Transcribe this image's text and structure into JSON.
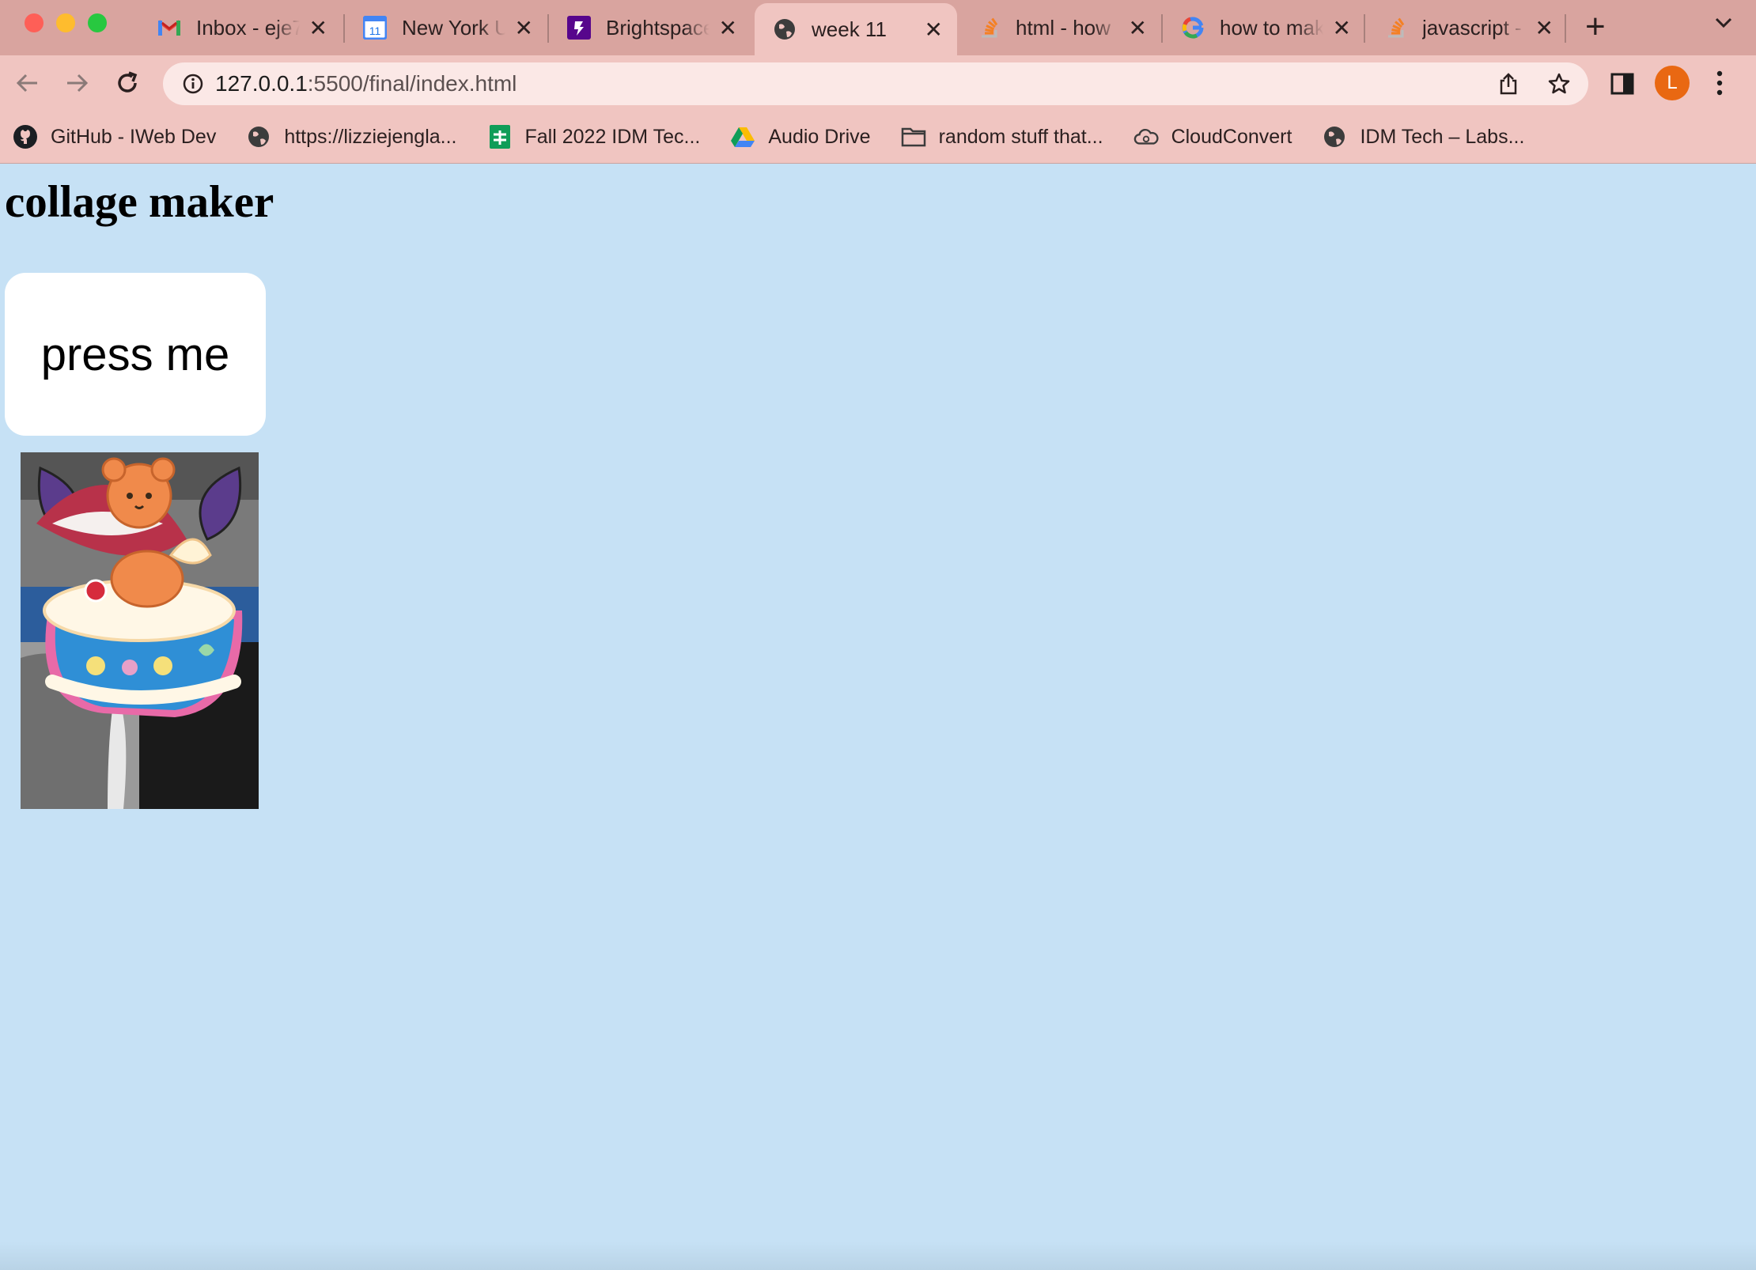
{
  "browser": {
    "tabs": [
      {
        "title": "Inbox - eje7",
        "favicon": "gmail-icon"
      },
      {
        "title": "New York U",
        "favicon": "calendar-icon"
      },
      {
        "title": "Brightspace",
        "favicon": "brightspace-icon"
      },
      {
        "title": "week 11",
        "favicon": "globe-icon",
        "active": true
      },
      {
        "title": "html - how",
        "favicon": "stackoverflow-icon"
      },
      {
        "title": "how to mak",
        "favicon": "google-icon"
      },
      {
        "title": "javascript -",
        "favicon": "stackoverflow-icon"
      }
    ],
    "new_tab_label": "+",
    "close_glyph": "✕",
    "calendar_day": "11",
    "url_host": "127.0.0.1",
    "url_path": ":5500/final/index.html",
    "avatar_letter": "L",
    "bookmarks": [
      {
        "label": "GitHub - IWeb Dev",
        "icon": "github-icon"
      },
      {
        "label": "https://lizziejengla...",
        "icon": "globe-icon"
      },
      {
        "label": "Fall 2022 IDM Tec...",
        "icon": "sheets-icon"
      },
      {
        "label": "Audio Drive",
        "icon": "drive-icon"
      },
      {
        "label": "random stuff that...",
        "icon": "folder-icon"
      },
      {
        "label": "CloudConvert",
        "icon": "cloud-icon"
      },
      {
        "label": "IDM Tech – Labs...",
        "icon": "globe-icon"
      }
    ],
    "colors": {
      "tabstrip": "#d9a49f",
      "toolbar": "#f0c5c1",
      "avatar": "#e96812"
    }
  },
  "page": {
    "heading": "collage maker",
    "button_label": "press me",
    "background": "#c6e1f5"
  }
}
